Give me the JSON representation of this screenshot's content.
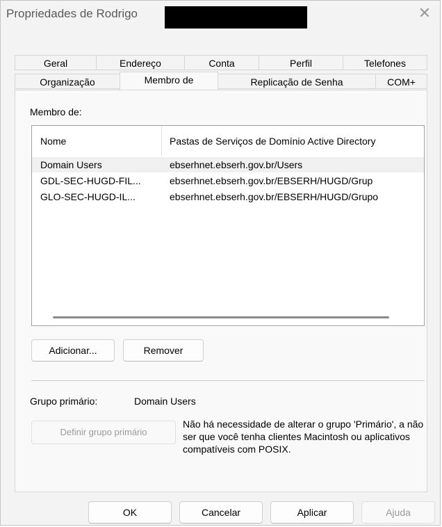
{
  "window": {
    "title": "Propriedades de Rodrigo",
    "close_glyph": "✕"
  },
  "tabs": {
    "row1": [
      "Geral",
      "Endereço",
      "Conta",
      "Perfil",
      "Telefones"
    ],
    "row2": [
      "Organização",
      "Membro de",
      "Replicação de Senha",
      "COM+"
    ],
    "active": "Membro de"
  },
  "membership": {
    "section_label": "Membro de:",
    "columns": [
      "Nome",
      "Pastas de Serviços de Domínio Active Directory"
    ],
    "rows": [
      {
        "name": "Domain Users",
        "path": "ebserhnet.ebserh.gov.br/Users"
      },
      {
        "name": "GDL-SEC-HUGD-FIL...",
        "path": "ebserhnet.ebserh.gov.br/EBSERH/HUGD/Grup"
      },
      {
        "name": "GLO-SEC-HUGD-IL...",
        "path": "ebserhnet.ebserh.gov.br/EBSERH/HUGD/Grupo"
      }
    ],
    "add_label": "Adicionar...",
    "remove_label": "Remover"
  },
  "primary_group": {
    "label": "Grupo primário:",
    "value": "Domain Users",
    "set_button": "Definir grupo primário",
    "note": "Não há necessidade de alterar o grupo 'Primário', a não ser que você tenha clientes Macintosh ou aplicativos compatíveis com POSIX."
  },
  "footer": {
    "ok": "OK",
    "cancel": "Cancelar",
    "apply": "Aplicar",
    "help": "Ajuda"
  }
}
